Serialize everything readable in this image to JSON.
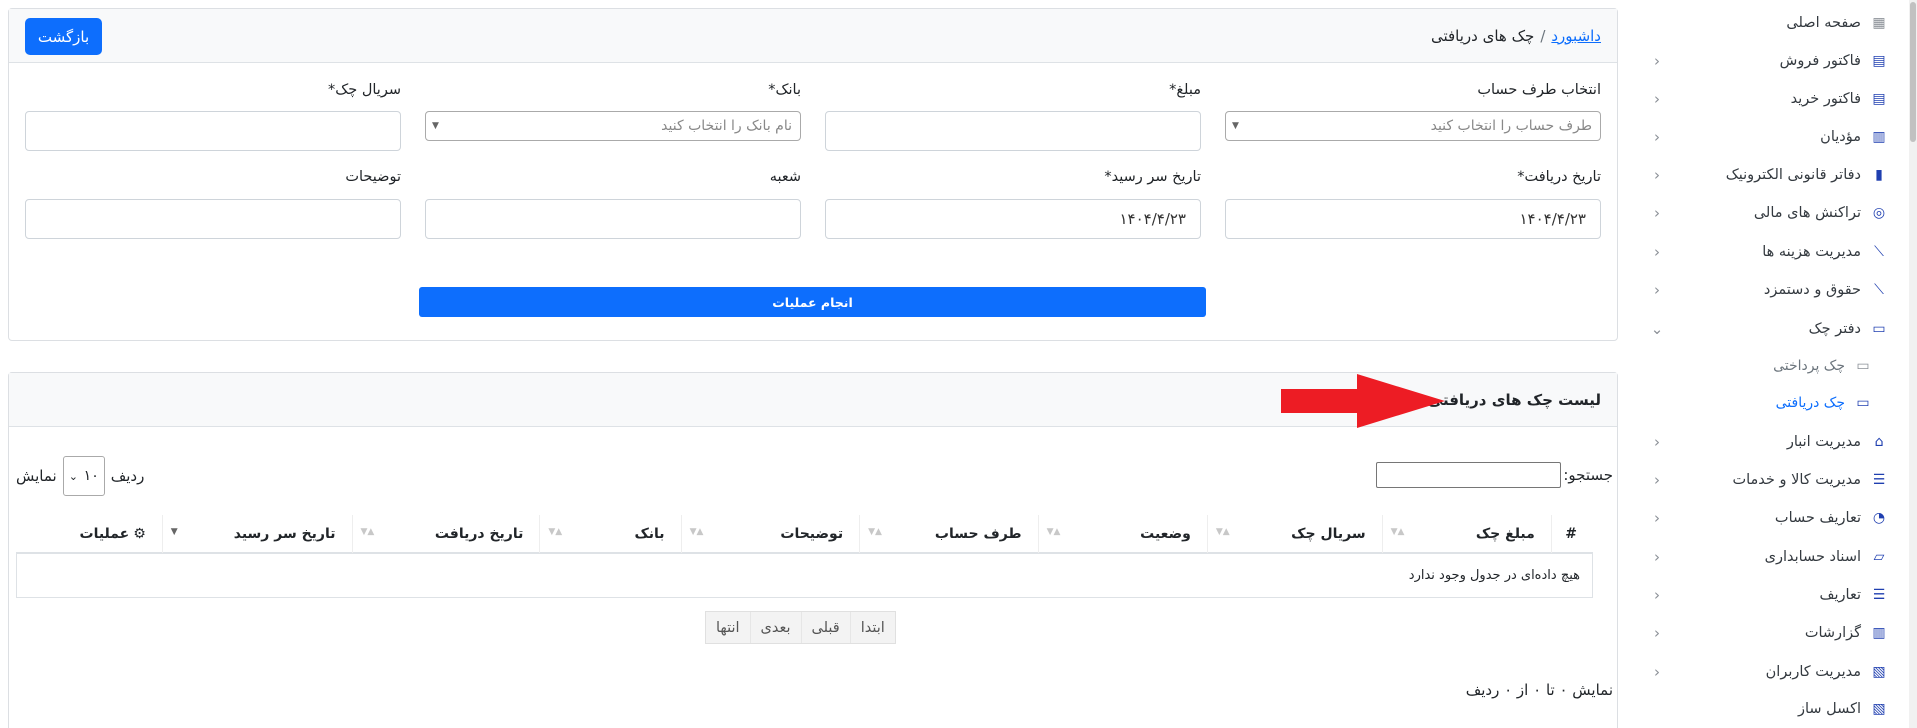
{
  "header": {
    "back_label": "بازگشت",
    "breadcrumb_root": "داشبورد",
    "breadcrumb_sep": "/",
    "breadcrumb_current": "چک های دریافتی"
  },
  "form": {
    "account_label": "انتخاب طرف حساب",
    "account_placeholder": "طرف حساب را انتخاب کنید",
    "amount_label": "مبلغ*",
    "amount_value": "",
    "bank_label": "بانک*",
    "bank_placeholder": "نام بانک را انتخاب کنید",
    "serial_label": "سریال چک*",
    "serial_value": "",
    "receive_date_label": "تاریخ دریافت*",
    "receive_date_value": "۱۴۰۴/۴/۲۳",
    "due_date_label": "تاریخ سر رسید*",
    "due_date_value": "۱۴۰۴/۴/۲۳",
    "branch_label": "شعبه",
    "branch_value": "",
    "notes_label": "توضیحات",
    "notes_value": "",
    "submit_label": "انجام عملیات"
  },
  "list": {
    "title": "لیست چک های دریافتی",
    "search_label": "جستجو:",
    "search_value": "",
    "length_show": "نمایش",
    "length_value": "۱۰",
    "length_rows": "ردیف",
    "columns": [
      "#",
      "مبلغ چک",
      "سریال چک",
      "وضعیت",
      "طرف حساب",
      "توضیحات",
      "بانک",
      "تاریخ دریافت",
      "تاریخ سر رسید",
      "عملیات"
    ],
    "empty_message": "هیچ داده‌ای در جدول وجود ندارد",
    "pager": [
      "ابتدا",
      "قبلی",
      "بعدی",
      "انتها"
    ],
    "info": "نمایش ۰ تا ۰ از ۰ ردیف"
  },
  "sidebar": {
    "items": [
      {
        "label": "صفحه اصلی",
        "icon": "dashboard-icon",
        "chevron": false
      },
      {
        "label": "فاکتور فروش",
        "icon": "invoice-icon",
        "chevron": true
      },
      {
        "label": "فاکتور خرید",
        "icon": "invoice-icon",
        "chevron": true
      },
      {
        "label": "مؤدیان",
        "icon": "chart-icon",
        "chevron": true
      },
      {
        "label": "دفاتر قانونی الکترونیک",
        "icon": "book-icon",
        "chevron": true
      },
      {
        "label": "تراکنش های مالی",
        "icon": "coins-icon",
        "chevron": true
      },
      {
        "label": "مدیریت هزینه ها",
        "icon": "line-chart-icon",
        "chevron": true
      },
      {
        "label": "حقوق و دستمزد",
        "icon": "line-chart-icon",
        "chevron": true
      },
      {
        "label": "دفتر چک",
        "icon": "money-icon",
        "chevron": true,
        "expanded": true
      },
      {
        "label": "چک پرداختی",
        "icon": "money-icon",
        "sub": true
      },
      {
        "label": "چک دریافتی",
        "icon": "money-icon",
        "sub": true,
        "active": true
      },
      {
        "label": "مدیریت انبار",
        "icon": "warehouse-icon",
        "chevron": true
      },
      {
        "label": "مدیریت کالا و خدمات",
        "icon": "list-icon",
        "chevron": true
      },
      {
        "label": "تعاریف حساب",
        "icon": "pie-icon",
        "chevron": true
      },
      {
        "label": "اسناد حسابداری",
        "icon": "folder-icon",
        "chevron": true
      },
      {
        "label": "تعاریف",
        "icon": "list-icon",
        "chevron": true
      },
      {
        "label": "گزارشات",
        "icon": "bar-chart-icon",
        "chevron": true
      },
      {
        "label": "مدیریت کاربران",
        "icon": "excel-icon",
        "chevron": true
      },
      {
        "label": "اکسل ساز",
        "icon": "excel-icon",
        "chevron": false
      }
    ]
  },
  "colors": {
    "primary": "#0d6efd",
    "annotation_arrow": "#ed1c24",
    "sidebar_icon": "#1f3fb0"
  }
}
